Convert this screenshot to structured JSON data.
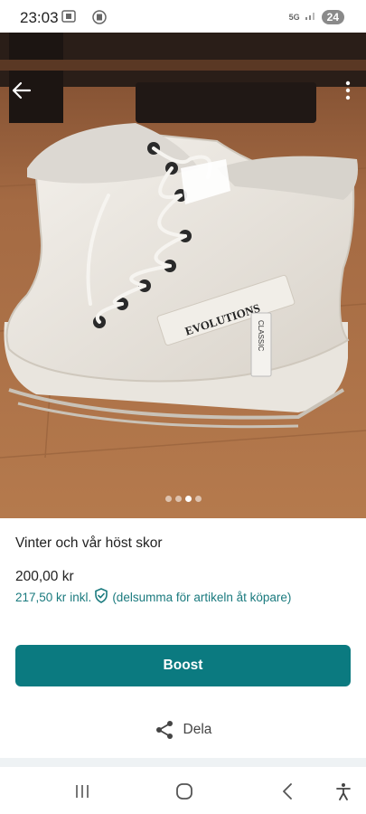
{
  "status_bar": {
    "time": "23:03",
    "network": "5G",
    "battery": "24"
  },
  "listing": {
    "title": "Vinter och vår höst skor",
    "price": "200,00 kr",
    "total_price": "217,50 kr",
    "total_incl": "inkl.",
    "buyer_protection_note": "(delsumma för artikeln åt köpare)",
    "photo_count": 4,
    "active_photo": 3
  },
  "product_photo": {
    "tag_text": "EVOLUTIONS",
    "charm_text": "CLASSIC"
  },
  "actions": {
    "boost_label": "Boost",
    "share_label": "Dela"
  },
  "icons": {
    "back": "arrow-left-icon",
    "more": "more-vertical-icon",
    "shield": "shield-check-icon",
    "share": "share-icon",
    "nav_recent": "recent-apps-icon",
    "nav_home": "home-icon",
    "nav_back": "chevron-left-icon",
    "nav_accessibility": "accessibility-icon"
  },
  "colors": {
    "accent": "#0b7a80",
    "link_text": "#1a7a7e",
    "separator": "#eef2f4"
  }
}
